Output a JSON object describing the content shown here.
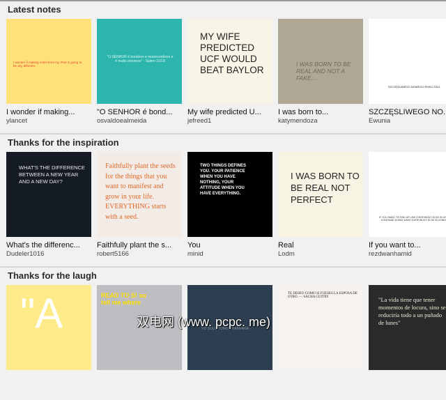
{
  "sections": [
    {
      "title": "Latest notes",
      "cards": [
        {
          "title": "I wonder if making...",
          "author": "ylancet",
          "art": "I wonder if making notes from my iPad is going to be any different.",
          "bg": "#fde27a",
          "fg": "#e8452c"
        },
        {
          "title": "\"O SENHOR é bond...",
          "author": "osvaldoealmeida",
          "art": "\"O SENHOR é bondoso e misericordioso e é muito amoroso\" - Salmo 103.8",
          "bg": "#2bb5ac",
          "fg": "#e6f7f5"
        },
        {
          "title": "My wife predicted U...",
          "author": "jefreed1",
          "art": "MY WIFE PREDICTED UCF WOULD BEAT BAYLOR",
          "bg": "#f8f5e6",
          "fg": "#222"
        },
        {
          "title": "I was born to...",
          "author": "katymendoza",
          "art": "I WAS BORN TO BE REAL AND NOT A FAKE...",
          "bg": "#b0a797",
          "fg": "#6e665b"
        },
        {
          "title": "SZCZĘŚLIWEGO NO...",
          "author": "Ewunia",
          "art": "SZCZĘŚLIWEGO NOWEGO ROKU 2014",
          "bg": "#ffffff",
          "fg": "#222"
        }
      ]
    },
    {
      "title": "Thanks for the inspiration",
      "cards": [
        {
          "title": "What's the differenc...",
          "author": "Dudeler1016",
          "art": "WHAT'S THE DIFFERENCE BETWEEN A NEW YEAR AND A NEW DAY?",
          "bg": "#141b24",
          "fg": "#e8e8e8"
        },
        {
          "title": "Faithfully plant the s...",
          "author": "robert5166",
          "art": "Faithfully plant the seeds for the things that you want to manifest and grow in your life. EVERYTHING starts with a seed.",
          "bg": "#f3ece6",
          "fg": "#e0682a"
        },
        {
          "title": "You",
          "author": "minid",
          "art": "TWO THINGS DEFINES YOU. YOUR PATIENCE WHEN YOU HAVE NOTHING, YOUR ATTITUDE WHEN YOU HAVE EVERYTHING.",
          "bg": "#000000",
          "fg": "#ffffff"
        },
        {
          "title": "Real",
          "author": "Lodm",
          "art": "I WAS BORN TO BE REAL NOT PERFECT",
          "bg": "#f8f4e4",
          "fg": "#222"
        },
        {
          "title": "If you want to...",
          "author": "rezdwanhamid",
          "art": "IF YOU WANT TO END UP LIKE EVERYBODY ELSE IN LIFE, CONTINUE DOING WHAT EVERYBODY ELSE IS DOING.",
          "bg": "#ffffff",
          "fg": "#333"
        }
      ]
    },
    {
      "title": "Thanks for the laugh",
      "cards": [
        {
          "title": "",
          "author": "",
          "art": "\"A",
          "bg": "#fdeb8a",
          "fg": "#ffffff"
        },
        {
          "title": "",
          "author": "",
          "art": "READ TO S! so tell me where",
          "bg": "#bdbdc2",
          "fg": "#111"
        },
        {
          "title": "",
          "author": "",
          "art": "YO SÓLO TOMO CHAMPAÑA",
          "bg": "#2c3e50",
          "fg": "#8795a3"
        },
        {
          "title": "",
          "author": "",
          "art": "TE DESEO COMO SI FUESES LA ESPOSA DE OTRO. — SACHA GUITRY",
          "bg": "#f6f2f0",
          "fg": "#222"
        },
        {
          "title": "",
          "author": "",
          "art": "\"La vida tiene que tener momentos de locura, sino se reduciría todo a un puñado de lunes\"",
          "bg": "#2a2a2a",
          "fg": "#f0e8d8"
        }
      ]
    }
  ],
  "watermark": "双电网 (www. pcpc. me)"
}
